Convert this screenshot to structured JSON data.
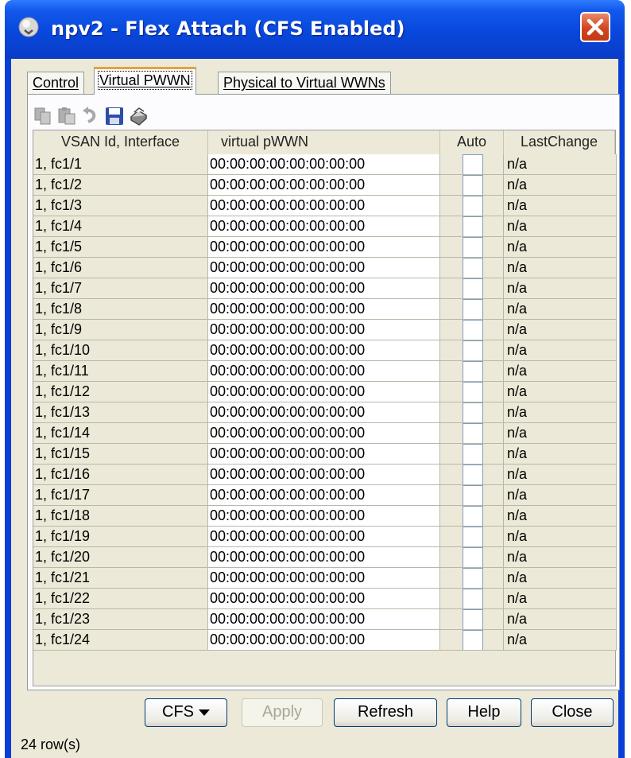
{
  "window": {
    "title": "npv2 - Flex Attach (CFS Enabled)"
  },
  "tabs": [
    {
      "label": "Control",
      "active": false
    },
    {
      "label": "Virtual PWWN",
      "active": true
    },
    {
      "label": "Physical to Virtual WWNs",
      "active": false
    }
  ],
  "toolbar": {
    "icons": [
      "copy-icon",
      "paste-icon",
      "undo-icon",
      "save-icon",
      "print-icon"
    ]
  },
  "table": {
    "columns": [
      "VSAN Id, Interface",
      "virtual pWWN",
      "Auto",
      "LastChange"
    ],
    "rows": [
      {
        "interface": "1, fc1/1",
        "pwwn": "00:00:00:00:00:00:00:00",
        "auto": false,
        "last_change": "n/a"
      },
      {
        "interface": "1, fc1/2",
        "pwwn": "00:00:00:00:00:00:00:00",
        "auto": false,
        "last_change": "n/a"
      },
      {
        "interface": "1, fc1/3",
        "pwwn": "00:00:00:00:00:00:00:00",
        "auto": false,
        "last_change": "n/a"
      },
      {
        "interface": "1, fc1/4",
        "pwwn": "00:00:00:00:00:00:00:00",
        "auto": false,
        "last_change": "n/a"
      },
      {
        "interface": "1, fc1/5",
        "pwwn": "00:00:00:00:00:00:00:00",
        "auto": false,
        "last_change": "n/a"
      },
      {
        "interface": "1, fc1/6",
        "pwwn": "00:00:00:00:00:00:00:00",
        "auto": false,
        "last_change": "n/a"
      },
      {
        "interface": "1, fc1/7",
        "pwwn": "00:00:00:00:00:00:00:00",
        "auto": false,
        "last_change": "n/a"
      },
      {
        "interface": "1, fc1/8",
        "pwwn": "00:00:00:00:00:00:00:00",
        "auto": false,
        "last_change": "n/a"
      },
      {
        "interface": "1, fc1/9",
        "pwwn": "00:00:00:00:00:00:00:00",
        "auto": false,
        "last_change": "n/a"
      },
      {
        "interface": "1, fc1/10",
        "pwwn": "00:00:00:00:00:00:00:00",
        "auto": false,
        "last_change": "n/a"
      },
      {
        "interface": "1, fc1/11",
        "pwwn": "00:00:00:00:00:00:00:00",
        "auto": false,
        "last_change": "n/a"
      },
      {
        "interface": "1, fc1/12",
        "pwwn": "00:00:00:00:00:00:00:00",
        "auto": false,
        "last_change": "n/a"
      },
      {
        "interface": "1, fc1/13",
        "pwwn": "00:00:00:00:00:00:00:00",
        "auto": false,
        "last_change": "n/a"
      },
      {
        "interface": "1, fc1/14",
        "pwwn": "00:00:00:00:00:00:00:00",
        "auto": false,
        "last_change": "n/a"
      },
      {
        "interface": "1, fc1/15",
        "pwwn": "00:00:00:00:00:00:00:00",
        "auto": false,
        "last_change": "n/a"
      },
      {
        "interface": "1, fc1/16",
        "pwwn": "00:00:00:00:00:00:00:00",
        "auto": false,
        "last_change": "n/a"
      },
      {
        "interface": "1, fc1/17",
        "pwwn": "00:00:00:00:00:00:00:00",
        "auto": false,
        "last_change": "n/a"
      },
      {
        "interface": "1, fc1/18",
        "pwwn": "00:00:00:00:00:00:00:00",
        "auto": false,
        "last_change": "n/a"
      },
      {
        "interface": "1, fc1/19",
        "pwwn": "00:00:00:00:00:00:00:00",
        "auto": false,
        "last_change": "n/a"
      },
      {
        "interface": "1, fc1/20",
        "pwwn": "00:00:00:00:00:00:00:00",
        "auto": false,
        "last_change": "n/a"
      },
      {
        "interface": "1, fc1/21",
        "pwwn": "00:00:00:00:00:00:00:00",
        "auto": false,
        "last_change": "n/a"
      },
      {
        "interface": "1, fc1/22",
        "pwwn": "00:00:00:00:00:00:00:00",
        "auto": false,
        "last_change": "n/a"
      },
      {
        "interface": "1, fc1/23",
        "pwwn": "00:00:00:00:00:00:00:00",
        "auto": false,
        "last_change": "n/a"
      },
      {
        "interface": "1, fc1/24",
        "pwwn": "00:00:00:00:00:00:00:00",
        "auto": false,
        "last_change": "n/a"
      }
    ]
  },
  "buttons": {
    "cfs": "CFS",
    "apply": "Apply",
    "refresh": "Refresh",
    "help": "Help",
    "close": "Close"
  },
  "status": "24 row(s)",
  "colors": {
    "titlebar": "#0a40cf",
    "dialog_background": "#ece9d8",
    "active_tab_accent": "#e3a23e"
  }
}
